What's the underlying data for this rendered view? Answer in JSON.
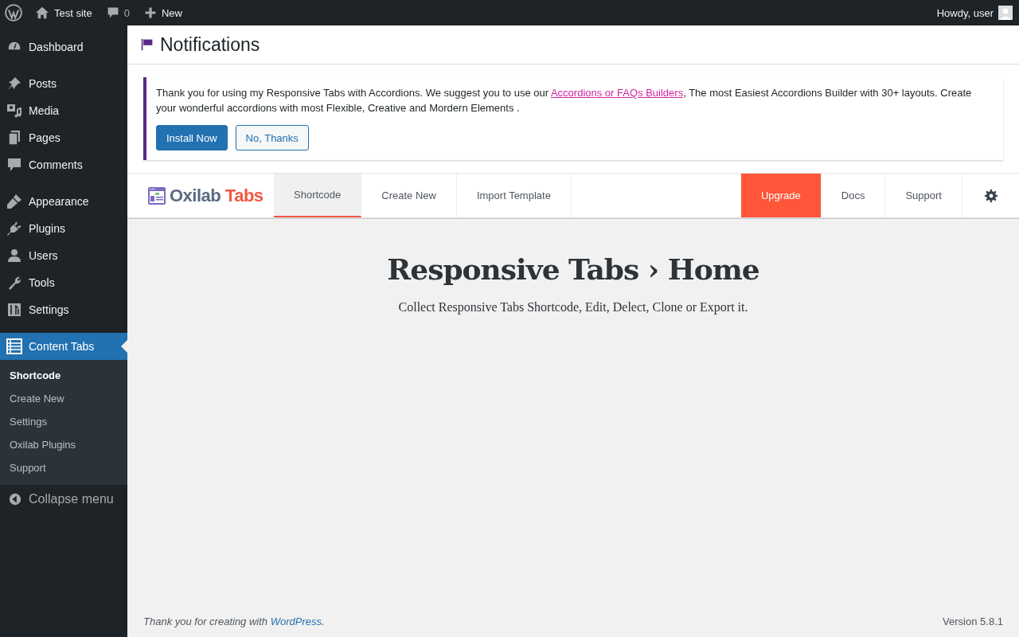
{
  "admin_bar": {
    "site": "Test site",
    "comments": "0",
    "new": "New",
    "greeting": "Howdy, user"
  },
  "sidebar": {
    "groups": [
      [
        {
          "label": "Dashboard",
          "selected": false
        }
      ],
      [
        {
          "label": "Posts",
          "selected": false
        },
        {
          "label": "Media",
          "selected": false
        },
        {
          "label": "Pages",
          "selected": false
        },
        {
          "label": "Comments",
          "selected": false
        }
      ],
      [
        {
          "label": "Appearance",
          "selected": false
        },
        {
          "label": "Plugins",
          "selected": false
        },
        {
          "label": "Users",
          "selected": false
        },
        {
          "label": "Tools",
          "selected": false
        },
        {
          "label": "Settings",
          "selected": false
        }
      ],
      [
        {
          "label": "Content Tabs",
          "selected": true
        }
      ]
    ],
    "submenu": [
      {
        "label": "Shortcode",
        "selected": true
      },
      {
        "label": "Create New",
        "selected": false
      },
      {
        "label": "Settings",
        "selected": false
      },
      {
        "label": "Oxilab Plugins",
        "selected": false
      },
      {
        "label": "Support",
        "selected": false
      }
    ],
    "collapse": "Collapse menu"
  },
  "notice": {
    "title": "Notifications",
    "text_before": "Thank you for using my Responsive Tabs with Accordions. We suggest you to use our ",
    "link": "Accordions or FAQs Builders",
    "text_after": ", The most Easiest Accordions Builder with 30+ layouts. Create your wonderful accordions with most Flexible, Creative and Mordern Elements .",
    "buttons": [
      {
        "label": "Install Now",
        "kind": "primary"
      },
      {
        "label": "No, Thanks",
        "kind": "secondary"
      }
    ]
  },
  "plugin_nav": {
    "brand": "Oxilab",
    "brand_accent": "Tabs",
    "tabs": [
      {
        "label": "Shortcode",
        "selected": true,
        "kind": "tab"
      },
      {
        "label": "Create New",
        "selected": false,
        "kind": "tab"
      },
      {
        "label": "Import Template",
        "selected": false,
        "kind": "tab"
      },
      {
        "label": "Upgrade",
        "selected": false,
        "kind": "upgrade"
      },
      {
        "label": "Docs",
        "selected": false,
        "kind": "tab"
      },
      {
        "label": "Support",
        "selected": false,
        "kind": "tab"
      }
    ]
  },
  "hero": {
    "title": "Responsive Tabs › Home",
    "subtitle": "Collect Responsive Tabs Shortcode, Edit, Delect, Clone or Export it."
  },
  "footer": {
    "text": "Thank you for creating with ",
    "link": "WordPress",
    "text_after": ".",
    "version": "Version 5.8.1"
  }
}
